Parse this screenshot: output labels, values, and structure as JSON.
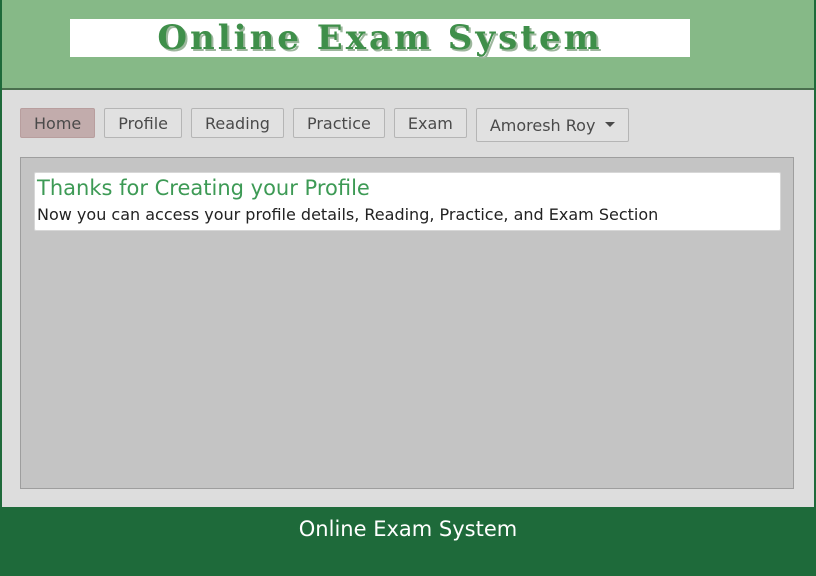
{
  "header": {
    "logo_text": "Online Exam System"
  },
  "nav": {
    "items": [
      {
        "label": "Home",
        "active": true
      },
      {
        "label": "Profile",
        "active": false
      },
      {
        "label": "Reading",
        "active": false
      },
      {
        "label": "Practice",
        "active": false
      },
      {
        "label": "Exam",
        "active": false
      }
    ],
    "user_menu_label": "Amoresh Roy"
  },
  "message": {
    "title": "Thanks for Creating your Profile",
    "body": "Now you can access your profile details, Reading, Practice, and Exam Section"
  },
  "footer": {
    "text": "Online Exam System"
  },
  "colors": {
    "header_bg": "#86b987",
    "footer_bg": "#1e6a3a",
    "active_tab": "#c2acac",
    "title_green": "#3d9a55"
  }
}
